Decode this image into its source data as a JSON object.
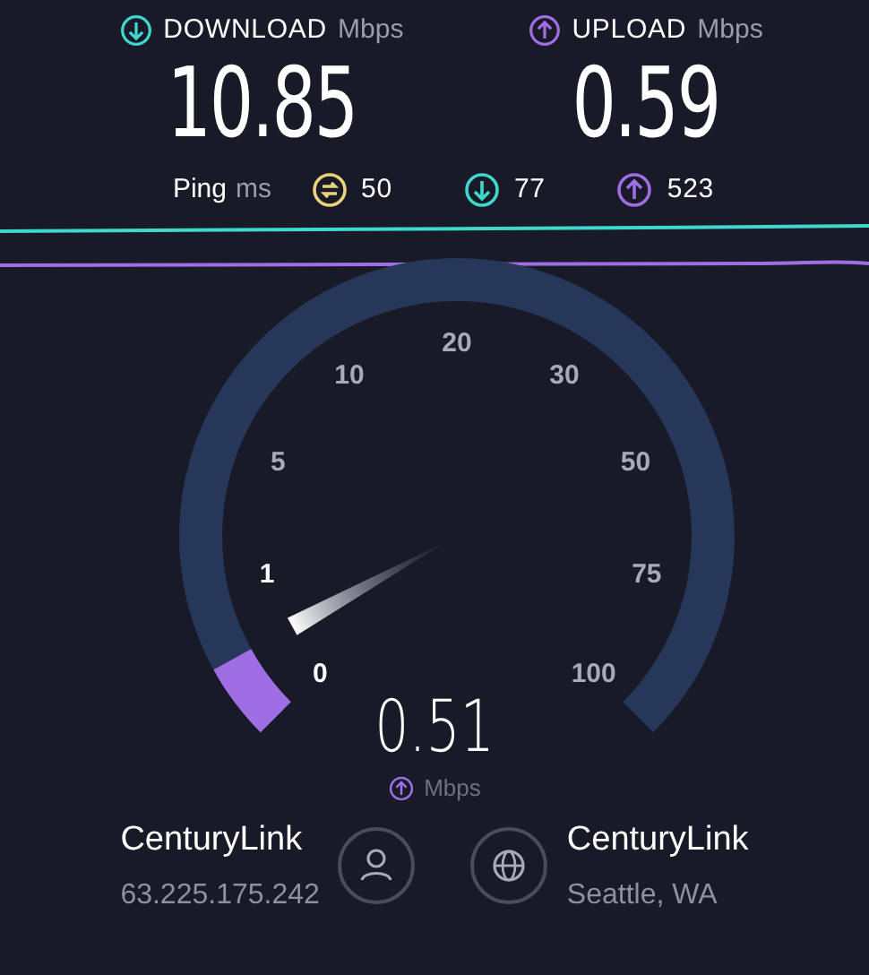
{
  "results": [
    {
      "kind": "download",
      "label": "DOWNLOAD",
      "unit": "Mbps",
      "value": "10.85"
    },
    {
      "kind": "upload",
      "label": "UPLOAD",
      "unit": "Mbps",
      "value": "0.59"
    }
  ],
  "ping": {
    "label": "Ping",
    "unit": "ms",
    "items": [
      {
        "kind": "idle",
        "value": "50"
      },
      {
        "kind": "download",
        "value": "77"
      },
      {
        "kind": "upload",
        "value": "523"
      }
    ]
  },
  "gauge": {
    "kind": "upload",
    "reading": "0.51",
    "unit": "Mbps",
    "scale_labels": [
      "0",
      "1",
      "5",
      "10",
      "20",
      "30",
      "50",
      "75",
      "100"
    ]
  },
  "client": {
    "provider": "CenturyLink",
    "detail": "63.225.175.242"
  },
  "server": {
    "provider": "CenturyLink",
    "detail": "Seattle, WA"
  }
}
